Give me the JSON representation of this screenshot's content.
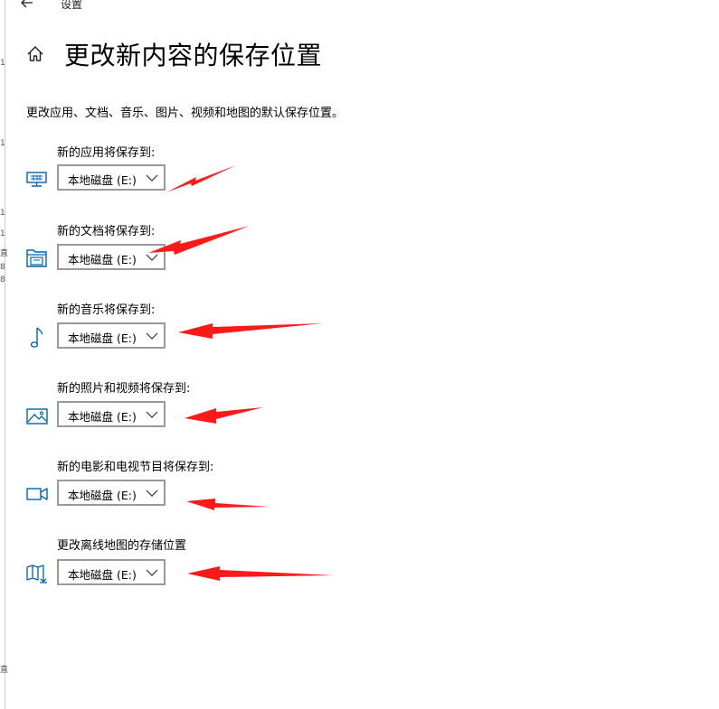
{
  "window": {
    "app_title": "设置",
    "back_icon": "back-arrow-icon"
  },
  "page": {
    "home_icon": "home-icon",
    "title": "更改新内容的保存位置",
    "description": "更改应用、文档、音乐、图片、视频和地图的默认保存位置。"
  },
  "settings": [
    {
      "label": "新的应用将保存到:",
      "icon": "monitor-icon",
      "value": "本地磁盘 (E:)"
    },
    {
      "label": "新的文档将保存到:",
      "icon": "documents-folder-icon",
      "value": "本地磁盘 (E:)"
    },
    {
      "label": "新的音乐将保存到:",
      "icon": "music-note-icon",
      "value": "本地磁盘 (E:)"
    },
    {
      "label": "新的照片和视频将保存到:",
      "icon": "picture-icon",
      "value": "本地磁盘 (E:)"
    },
    {
      "label": "新的电影和电视节目将保存到:",
      "icon": "video-camera-icon",
      "value": "本地磁盘 (E:)"
    },
    {
      "label": "更改离线地图的存储位置",
      "icon": "map-download-icon",
      "value": "本地磁盘 (E:)"
    }
  ],
  "colors": {
    "accent_icon": "#0063b1",
    "annotation_arrow": "#ff1a1a",
    "dropdown_border": "#999999"
  },
  "left_edge_glyphs": [
    "1",
    "1",
    "1",
    "1",
    "直",
    "8",
    "8",
    "直"
  ]
}
